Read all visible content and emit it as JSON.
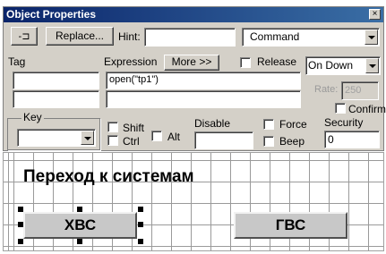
{
  "window": {
    "title": "Object Properties",
    "close_glyph": "×"
  },
  "toolbar": {
    "pin_icon": "pushpin-icon",
    "pin_glyph": "-⊐",
    "replace_label": "Replace...",
    "hint_label": "Hint:",
    "hint_value": "",
    "type_value": "Command"
  },
  "tag": {
    "label": "Tag",
    "value1": "",
    "value2": ""
  },
  "expression": {
    "label": "Expression",
    "more_label": "More >>",
    "value": "open(\"tp1\")",
    "value2": ""
  },
  "release": {
    "label": "Release"
  },
  "trigger": {
    "value": "On Down"
  },
  "rate": {
    "label": "Rate:",
    "value": "250"
  },
  "confirm": {
    "label": "Confirm"
  },
  "key": {
    "label": "Key",
    "value": "",
    "shift_label": "Shift",
    "ctrl_label": "Ctrl",
    "alt_label": "Alt"
  },
  "disable": {
    "label": "Disable",
    "value": ""
  },
  "force": {
    "label": "Force"
  },
  "beep": {
    "label": "Beep"
  },
  "security": {
    "label": "Security",
    "value": "0"
  },
  "canvas": {
    "heading": "Переход к системам",
    "button1": "ХВС",
    "button2": "ГВС"
  }
}
